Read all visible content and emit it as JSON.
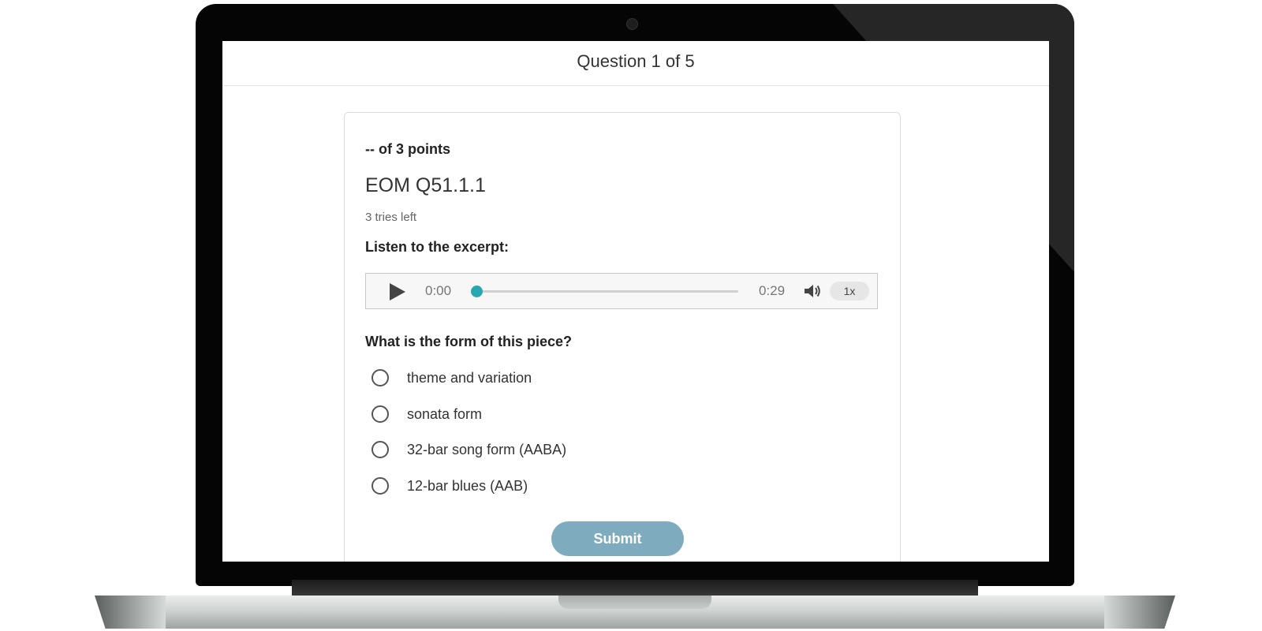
{
  "header": {
    "counter": "Question 1 of 5"
  },
  "question": {
    "points": "-- of 3 points",
    "title": "EOM Q51.1.1",
    "tries": "3 tries left",
    "instruction": "Listen to the excerpt:",
    "prompt": "What is the form of this piece?",
    "options": [
      {
        "label": "theme and variation",
        "selected": false
      },
      {
        "label": "sonata form",
        "selected": false
      },
      {
        "label": "32-bar song form (AABA)",
        "selected": false
      },
      {
        "label": "12-bar blues (AAB)",
        "selected": false
      }
    ],
    "submit_label": "Submit"
  },
  "audio": {
    "current_time": "0:00",
    "duration": "0:29",
    "progress": 0,
    "speed": "1x",
    "play_icon": "play-icon",
    "volume_icon": "volume-icon"
  },
  "colors": {
    "accent": "#2aa8b0",
    "submit": "#7fabbe",
    "text": "#333333"
  }
}
